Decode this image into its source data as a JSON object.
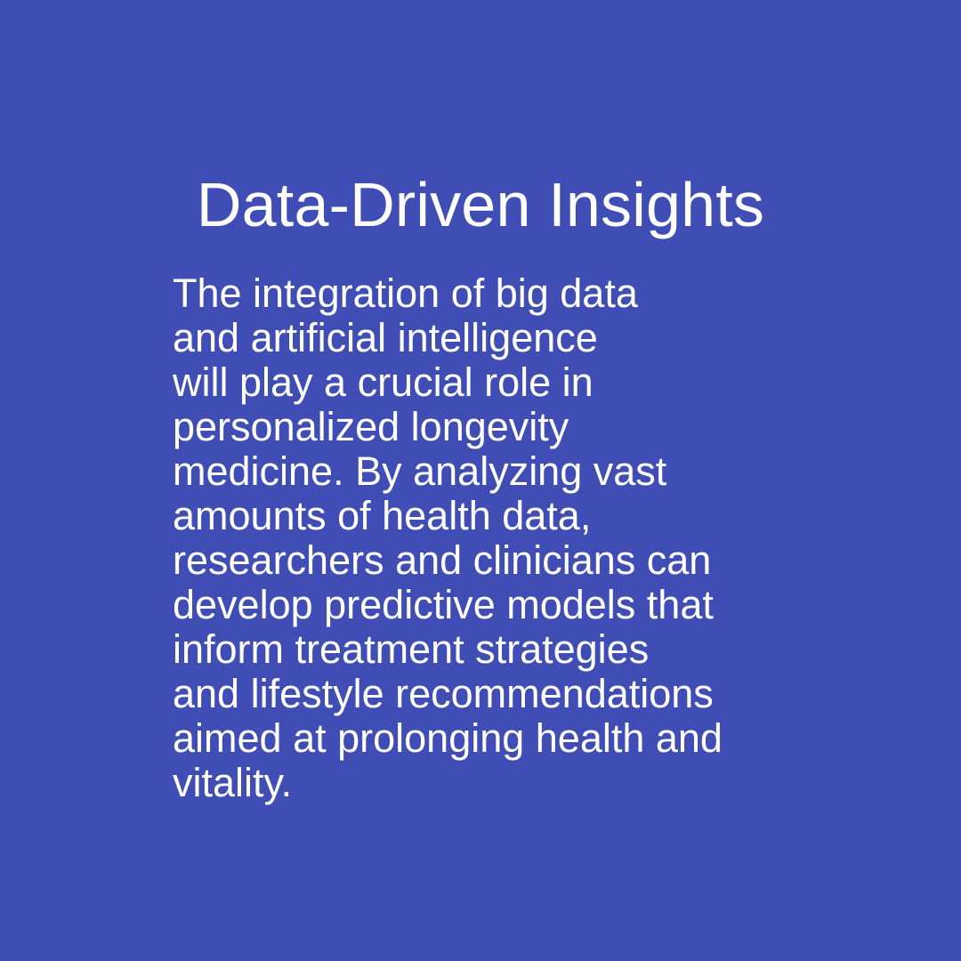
{
  "slide": {
    "background_color": "#404db4",
    "text_color": "#ffffff",
    "title": "Data-Driven Insights",
    "body_lines": [
      "The integration of big data",
      "and artificial intelligence",
      "will play a crucial role in",
      "personalized longevity",
      "medicine. By analyzing vast",
      "amounts of health data,",
      "researchers and clinicians can",
      "develop predictive models that",
      "inform treatment strategies",
      "and lifestyle recommendations",
      "aimed at prolonging health and",
      "vitality."
    ]
  }
}
